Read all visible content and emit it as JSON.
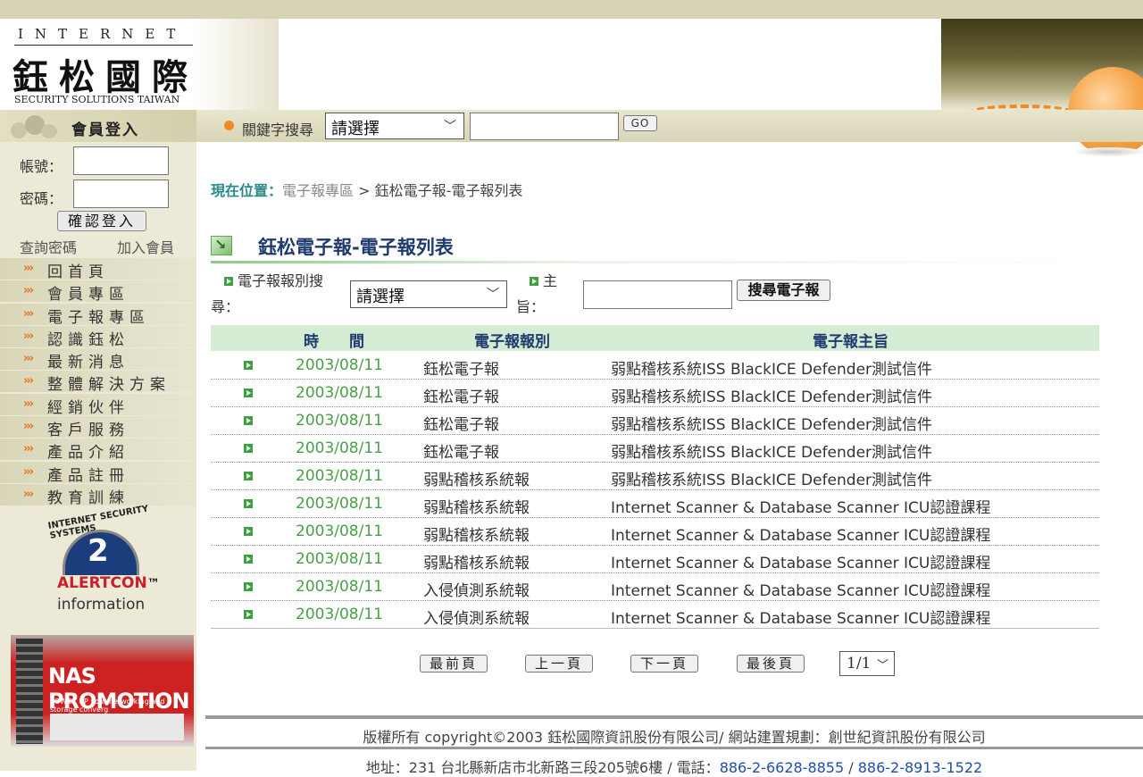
{
  "header": {
    "logo_line1": "INTERNET",
    "logo_line2": "鈺松國際",
    "logo_line3": "SECURITY SOLUTIONS TAIWAN"
  },
  "login": {
    "title": "會員登入",
    "account_label": "帳號：",
    "account_value": "",
    "password_label": "密碼：",
    "password_value": "",
    "submit": "確認登入",
    "forgot": "查詢密碼",
    "join": "加入會員"
  },
  "menu": [
    {
      "label": "回首頁"
    },
    {
      "label": "會員專區"
    },
    {
      "label": "電子報專區"
    },
    {
      "label": "認識鈺松"
    },
    {
      "label": "最新消息"
    },
    {
      "label": "整體解決方案"
    },
    {
      "label": "經銷伙伴"
    },
    {
      "label": "客戶服務"
    },
    {
      "label": "產品介紹"
    },
    {
      "label": "產品註冊"
    },
    {
      "label": "教育訓練"
    }
  ],
  "menu_arrow": "›››",
  "alertcon": {
    "arc_text": "INTERNET SECURITY SYSTEMS",
    "level": "2",
    "name_a": "ALERT",
    "name_b": "CON",
    "tm": "™",
    "info": "information"
  },
  "promo": {
    "title": "NAS PROMOTION",
    "subtitle": "POWER UP your networking and storage converg"
  },
  "search": {
    "label": "關鍵字搜尋",
    "select_value": "請選擇",
    "input_value": "",
    "go": "GO"
  },
  "breadcrumb": {
    "prefix": "現在位置：",
    "link": "電子報專區",
    "sep": " > ",
    "current": "鈺松電子報-電子報列表"
  },
  "page_title": "鈺松電子報-電子報列表",
  "filter": {
    "type_label_a": "電子報報別搜",
    "type_label_b": "尋：",
    "type_value": "請選擇",
    "subject_label_a": "主",
    "subject_label_b": "旨：",
    "subject_value": "",
    "button": "搜尋電子報"
  },
  "table": {
    "headers": [
      "時　　間",
      "電子報報別",
      "電子報主旨"
    ],
    "rows": [
      {
        "date": "2003/08/11",
        "category": "鈺松電子報",
        "subject": "弱點稽核系統ISS BlackICE Defender測試信件"
      },
      {
        "date": "2003/08/11",
        "category": "鈺松電子報",
        "subject": "弱點稽核系統ISS BlackICE Defender測試信件"
      },
      {
        "date": "2003/08/11",
        "category": "鈺松電子報",
        "subject": "弱點稽核系統ISS BlackICE Defender測試信件"
      },
      {
        "date": "2003/08/11",
        "category": "鈺松電子報",
        "subject": "弱點稽核系統ISS BlackICE Defender測試信件"
      },
      {
        "date": "2003/08/11",
        "category": "弱點稽核系統報",
        "subject": "弱點稽核系統ISS BlackICE Defender測試信件"
      },
      {
        "date": "2003/08/11",
        "category": "弱點稽核系統報",
        "subject": "Internet Scanner & Database Scanner ICU認證課程"
      },
      {
        "date": "2003/08/11",
        "category": "弱點稽核系統報",
        "subject": "Internet Scanner & Database Scanner ICU認證課程"
      },
      {
        "date": "2003/08/11",
        "category": "弱點稽核系統報",
        "subject": "Internet Scanner & Database Scanner ICU認證課程"
      },
      {
        "date": "2003/08/11",
        "category": "入侵偵測系統報",
        "subject": "Internet Scanner & Database Scanner ICU認證課程"
      },
      {
        "date": "2003/08/11",
        "category": "入侵偵測系統報",
        "subject": "Internet Scanner & Database Scanner ICU認證課程"
      }
    ]
  },
  "pager": {
    "first": "最前頁",
    "prev": "上一頁",
    "next": "下一頁",
    "last": "最後頁",
    "page_value": "1/1"
  },
  "footer": {
    "copyright": "版權所有 copyright©2003 鈺松國際資訊股份有限公司/ 網站建置規劃：創世紀資訊股份有限公司",
    "address": "地址：231 台北縣新店市北新路三段205號6樓 / 電話：",
    "phone1": "886-2-6628-8855",
    "phone_sep": " / ",
    "phone2": "886-2-8913-1522"
  }
}
